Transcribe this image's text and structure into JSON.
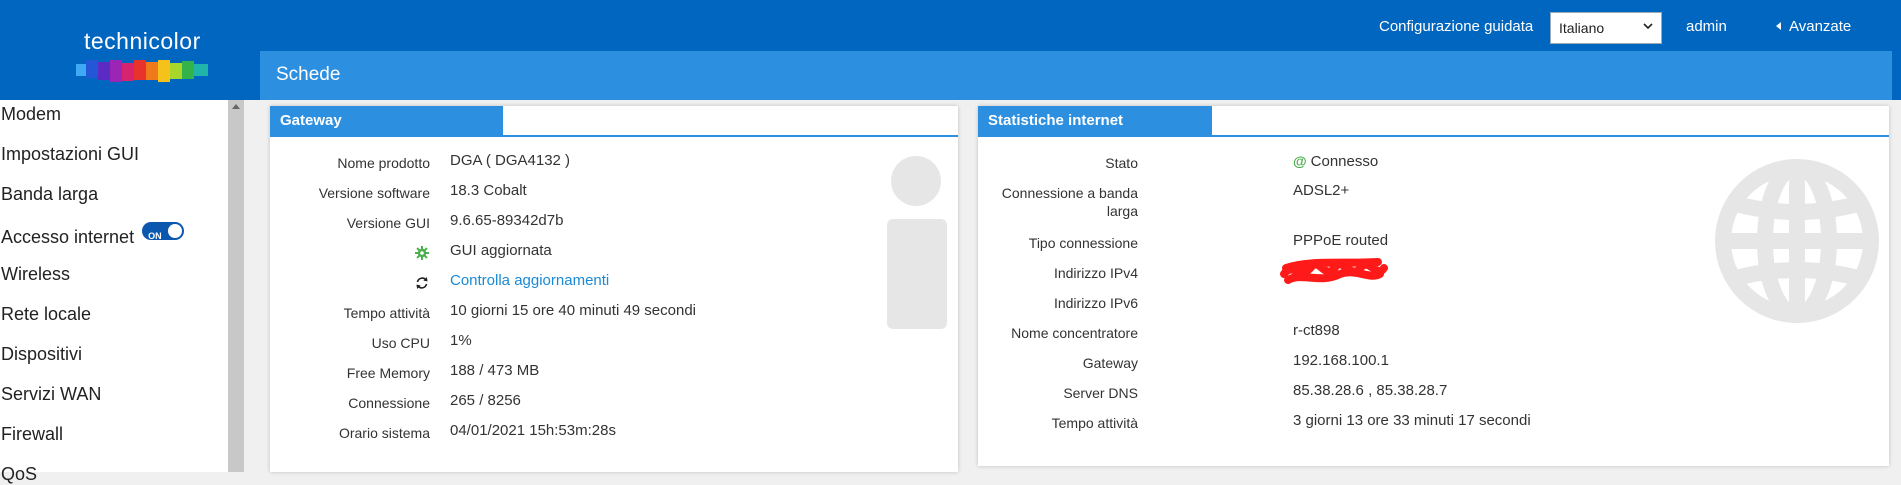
{
  "header": {
    "brand": "technicolor",
    "wizard_label": "Configurazione guidata",
    "language_selected": "Italiano",
    "user": "admin",
    "advanced_label": "Avanzate",
    "page_title": "Schede",
    "color": "#0066c0",
    "accent": "#2d8fe0"
  },
  "sidebar": {
    "items": [
      {
        "label": "Modem"
      },
      {
        "label": "Impostazioni GUI"
      },
      {
        "label": "Banda larga"
      },
      {
        "label": "Accesso internet",
        "toggle": "ON"
      },
      {
        "label": "Wireless"
      },
      {
        "label": "Rete locale"
      },
      {
        "label": "Dispositivi"
      },
      {
        "label": "Servizi WAN"
      },
      {
        "label": "Firewall"
      },
      {
        "label": "QoS"
      }
    ]
  },
  "gateway": {
    "title": "Gateway",
    "rows": [
      {
        "label": "Nome prodotto",
        "value": "DGA ( DGA4132 )"
      },
      {
        "label": "Versione software",
        "value": "18.3 Cobalt"
      },
      {
        "label": "Versione GUI",
        "value": "9.6.65-89342d7b"
      },
      {
        "icon": "gear-icon",
        "value": "GUI aggiornata"
      },
      {
        "icon": "refresh-icon",
        "value": "Controlla aggiornamenti"
      },
      {
        "label": "Tempo attività",
        "value": "10 giorni 15 ore 40 minuti 49 secondi"
      },
      {
        "label": "Uso CPU",
        "value": "1%"
      },
      {
        "label": "Free Memory",
        "value": "188 / 473 MB"
      },
      {
        "label": "Connessione",
        "value": "265 / 8256"
      },
      {
        "label": "Orario sistema",
        "value": "04/01/2021 15h:53m:28s"
      }
    ]
  },
  "internet": {
    "title": "Statistiche internet",
    "rows": [
      {
        "label": "Stato",
        "value": "Connesso",
        "icon": "at-icon"
      },
      {
        "label": "Connessione a banda larga",
        "value": "ADSL2+"
      },
      {
        "label": "Tipo connessione",
        "value": "PPPoE routed"
      },
      {
        "label": "Indirizzo IPv4",
        "value": ""
      },
      {
        "label": "Indirizzo IPv6",
        "value": ""
      },
      {
        "label": "Nome concentratore",
        "value": "r-ct898"
      },
      {
        "label": "Gateway",
        "value": "192.168.100.1"
      },
      {
        "label": "Server DNS",
        "value": "85.38.28.6 , 85.38.28.7"
      },
      {
        "label": "Tempo attività",
        "value": "3 giorni 13 ore 33 minuti 17 secondi"
      }
    ]
  }
}
